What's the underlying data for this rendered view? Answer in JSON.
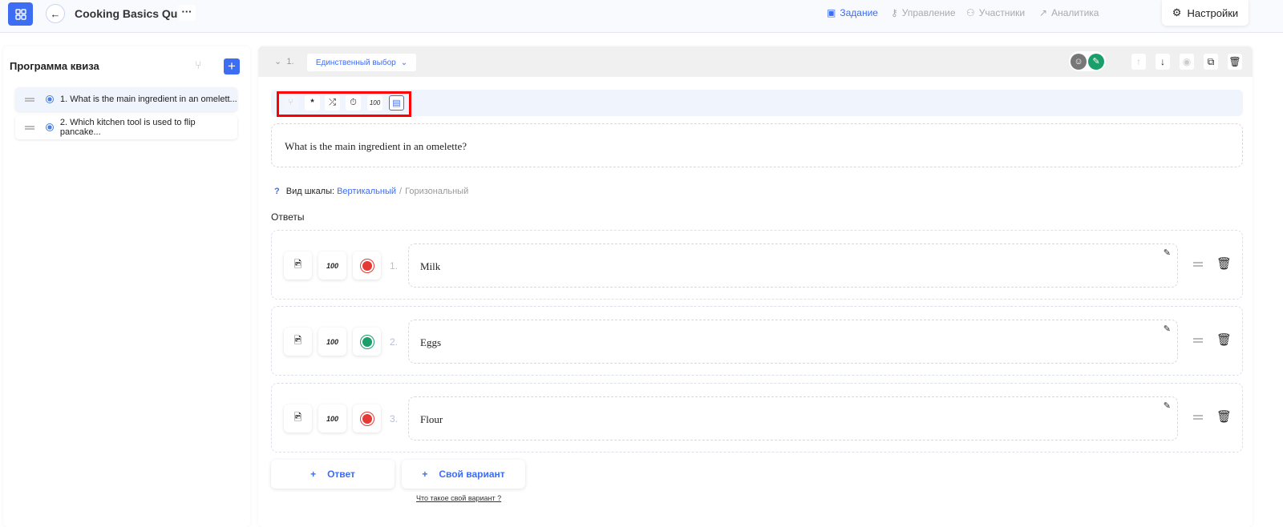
{
  "header": {
    "title": "Cooking Basics Quiz",
    "more": "···",
    "nav": [
      {
        "label": "Задание",
        "active": true
      },
      {
        "label": "Управление"
      },
      {
        "label": "Участники"
      },
      {
        "label": "Аналитика"
      }
    ],
    "settings": "Настройки"
  },
  "sidebar": {
    "title": "Программа квиза",
    "items": [
      {
        "label": "1. What is the main ingredient in an omelett..."
      },
      {
        "label": "2. Which kitchen tool is used to flip pancake..."
      }
    ]
  },
  "question": {
    "number": "1.",
    "type": "Единственный выбор",
    "text": "What is the main ingredient in an omelette?",
    "scale_hint": "?",
    "scale_label": "Вид шкалы:",
    "scale_vertical": "Вертикальный",
    "scale_sep": "/",
    "scale_horizontal": "Горизональный",
    "answers_title": "Ответы"
  },
  "answers": [
    {
      "num": "1.",
      "text": "Milk",
      "correct": false
    },
    {
      "num": "2.",
      "text": "Eggs",
      "correct": true
    },
    {
      "num": "3.",
      "text": "Flour",
      "correct": false
    }
  ],
  "buttons": {
    "add_answer": "Ответ",
    "own_variant": "Свой вариант",
    "own_help": "Что такое свой вариант ?"
  },
  "colors": {
    "accent": "#3d6df2",
    "correct": "#1a9e6a",
    "wrong": "#e53935"
  }
}
